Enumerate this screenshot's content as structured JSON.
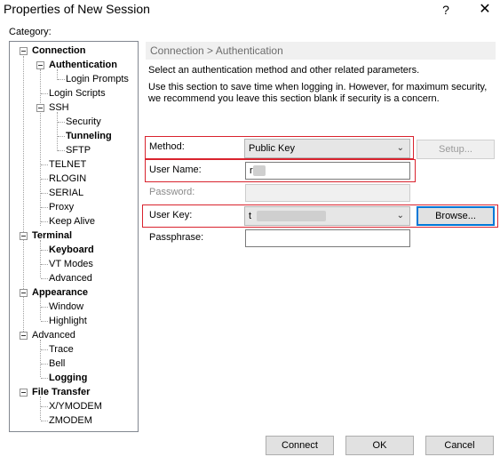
{
  "window": {
    "title": "Properties of New Session",
    "help_glyph": "?",
    "close_glyph": "✕"
  },
  "category": {
    "label": "Category:",
    "tree": {
      "connection": "Connection",
      "authentication": "Authentication",
      "login_prompts": "Login Prompts",
      "login_scripts": "Login Scripts",
      "ssh": "SSH",
      "security": "Security",
      "tunneling": "Tunneling",
      "sftp": "SFTP",
      "telnet": "TELNET",
      "rlogin": "RLOGIN",
      "serial": "SERIAL",
      "proxy": "Proxy",
      "keep_alive": "Keep Alive",
      "terminal": "Terminal",
      "keyboard": "Keyboard",
      "vt_modes": "VT Modes",
      "advanced_terminal": "Advanced",
      "appearance": "Appearance",
      "window": "Window",
      "highlight": "Highlight",
      "advanced": "Advanced",
      "trace": "Trace",
      "bell": "Bell",
      "logging": "Logging",
      "file_transfer": "File Transfer",
      "xymodem": "X/YMODEM",
      "zmodem": "ZMODEM"
    }
  },
  "panel": {
    "breadcrumb": "Connection > Authentication",
    "desc1": "Select an authentication method and other related parameters.",
    "desc2": "Use this section to save time when logging in. However, for maximum security,",
    "desc3": "we recommend you leave this section blank if security is a concern.",
    "method_label": "Method:",
    "method_value": "Public Key",
    "setup_label": "Setup...",
    "username_label": "User Name:",
    "username_value": "r",
    "password_label": "Password:",
    "userkey_label": "User Key:",
    "userkey_value": "t",
    "browse_label": "Browse...",
    "passphrase_label": "Passphrase:",
    "chevron_icon": "chevron-down-icon"
  },
  "footer": {
    "connect_label": "Connect",
    "ok_label": "OK",
    "cancel_label": "Cancel"
  },
  "colors": {
    "highlight_border": "#d9232e",
    "default_button_border": "#0078d7"
  }
}
